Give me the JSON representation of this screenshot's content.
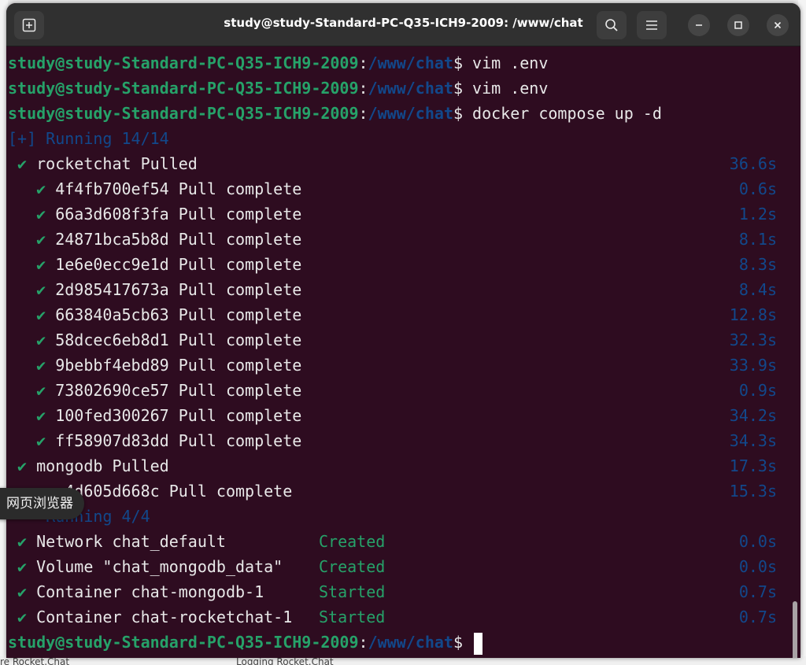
{
  "window": {
    "title": "study@study-Standard-PC-Q35-ICH9-2009: /www/chat"
  },
  "prompt": {
    "user_host": "study@study-Standard-PC-Q35-ICH9-2009",
    "path": "/www/chat",
    "symbol": "$"
  },
  "commands": [
    "vim .env",
    "vim .env",
    "docker compose up -d"
  ],
  "running1": "[+] Running 14/14",
  "rocketchat": {
    "name": "rocketchat Pulled",
    "time": "36.6s"
  },
  "layers": [
    {
      "id": "4f4fb700ef54",
      "status": "Pull complete",
      "time": "0.6s"
    },
    {
      "id": "66a3d608f3fa",
      "status": "Pull complete",
      "time": "1.2s"
    },
    {
      "id": "24871bca5b8d",
      "status": "Pull complete",
      "time": "8.1s"
    },
    {
      "id": "1e6e0ecc9e1d",
      "status": "Pull complete",
      "time": "8.3s"
    },
    {
      "id": "2d985417673a",
      "status": "Pull complete",
      "time": "8.4s"
    },
    {
      "id": "663840a5cb63",
      "status": "Pull complete",
      "time": "12.8s"
    },
    {
      "id": "58dcec6eb8d1",
      "status": "Pull complete",
      "time": "32.3s"
    },
    {
      "id": "9bebbf4ebd89",
      "status": "Pull complete",
      "time": "33.9s"
    },
    {
      "id": "73802690ce57",
      "status": "Pull complete",
      "time": "0.9s"
    },
    {
      "id": "100fed300267",
      "status": "Pull complete",
      "time": "34.2s"
    },
    {
      "id": "ff58907d83dd",
      "status": "Pull complete",
      "time": "34.3s"
    }
  ],
  "mongodb": {
    "name": "mongodb Pulled",
    "time": "17.3s"
  },
  "mongo_layer": {
    "text": "4d605d668c Pull complete",
    "time": "15.3s"
  },
  "running2": "Running 4/4",
  "resources": [
    {
      "name": "Network chat_default",
      "status": "Created",
      "time": "0.0s"
    },
    {
      "name": "Volume \"chat_mongodb_data\"",
      "status": "Created",
      "time": "0.0s"
    },
    {
      "name": "Container chat-mongodb-1",
      "status": "Started",
      "time": "0.7s"
    },
    {
      "name": "Container chat-rocketchat-1",
      "status": "Started",
      "time": "0.7s"
    }
  ],
  "tooltip": "网页浏览器",
  "background_text": {
    "bottom_left": "re Rocket.Chat",
    "bottom_center": "Logging Rocket.Chat"
  },
  "icons": {
    "check": "✔",
    "new_tab": "new-tab-icon",
    "search": "search-icon",
    "menu": "hamburger-menu-icon",
    "minimize": "minimize-icon",
    "maximize": "maximize-icon",
    "close": "close-icon"
  }
}
